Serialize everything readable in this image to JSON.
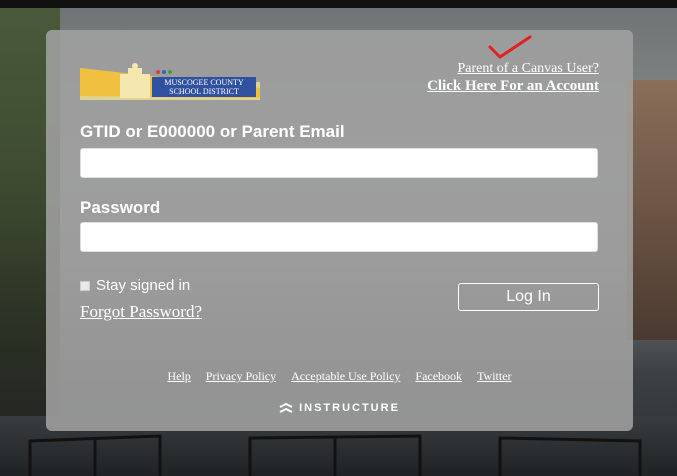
{
  "logo": {
    "name_line1": "MUSCOGEE COUNTY",
    "name_line2": "SCHOOL DISTRICT",
    "icon": "building-icon"
  },
  "parent_link": {
    "line1": "Parent of a Canvas User?",
    "line2": "Click Here For an Account"
  },
  "login": {
    "username_label": "GTID or E000000 or Parent Email",
    "username_value": "",
    "password_label": "Password",
    "password_value": "",
    "stay_signed_in": "Stay signed in",
    "forgot_password": "Forgot Password?",
    "login_button": "Log In"
  },
  "footer": {
    "links": [
      "Help",
      "Privacy Policy",
      "Acceptable Use Policy",
      "Facebook",
      "Twitter"
    ],
    "brand": "INSTRUCTURE"
  },
  "colors": {
    "panel": "#a0a0a0",
    "text": "#ffffff",
    "annotation_check": "#e02020"
  }
}
